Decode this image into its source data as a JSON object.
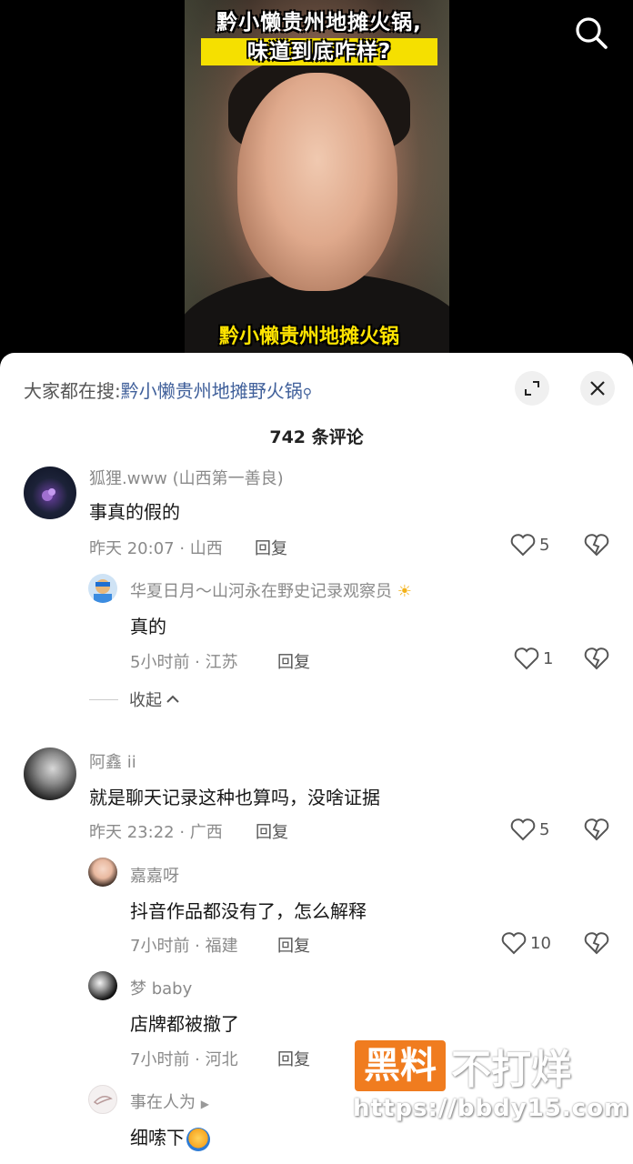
{
  "video": {
    "caption_top_line1": "黔小懒贵州地摊火锅,",
    "caption_top_line2": "味道到底咋样?",
    "caption_bottom": "黔小懒贵州地摊火锅"
  },
  "sheet": {
    "search_prefix": "大家都在搜:",
    "search_query": "黔小懒贵州地摊野火锅",
    "comment_count": "742 条评论"
  },
  "comments": [
    {
      "name": "狐狸.www (山西第一善良)",
      "text": "事真的假的",
      "meta": "昨天 20:07 · 山西",
      "reply": "回复",
      "likes": "5"
    },
    {
      "name": "华夏日月～山河永在野史记录观察员",
      "text": "真的",
      "meta": "5小时前 · 江苏",
      "reply": "回复",
      "likes": "1"
    },
    {
      "name": "阿鑫 ii",
      "text": "就是聊天记录这种也算吗，没啥证据",
      "meta": "昨天 23:22 · 广西",
      "reply": "回复",
      "likes": "5"
    },
    {
      "name": "嘉嘉呀",
      "text": "抖音作品都没有了，怎么解释",
      "meta": "7小时前 · 福建",
      "reply": "回复",
      "likes": "10"
    },
    {
      "name": "梦 baby",
      "text": "店牌都被撤了",
      "meta": "7小时前 · 河北",
      "reply": "回复"
    },
    {
      "name": "事在人为",
      "text": "细嗦下"
    }
  ],
  "collapse_label": "收起",
  "watermark": {
    "brand_box": "黑料",
    "brand_rest": "不打烊",
    "url": "https://bbdy15.com"
  },
  "colors": {
    "accent_link": "#3f5f9a",
    "caption_yellow": "#f5e000",
    "watermark_orange": "#f07c1f"
  }
}
